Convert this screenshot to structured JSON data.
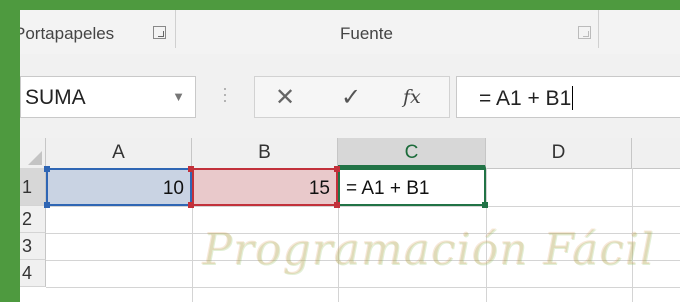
{
  "ribbon": {
    "group_clipboard": "Portapapeles",
    "group_font": "Fuente"
  },
  "formula_bar": {
    "name_box": "SUMA",
    "cancel_glyph": "✕",
    "enter_glyph": "✓",
    "fx_glyph": "fx",
    "formula": "= A1 + B1"
  },
  "sheet": {
    "columns": [
      "A",
      "B",
      "C",
      "D"
    ],
    "active_column": "C",
    "rows": [
      "1",
      "2",
      "3",
      "4"
    ],
    "cells": {
      "A1": "10",
      "B1": "15",
      "C1": "= A1 + B1"
    },
    "reference_colors": {
      "A1": "#2f66b4",
      "B1": "#c2313b",
      "active": "#217346"
    }
  },
  "watermark": "Programación Fácil"
}
